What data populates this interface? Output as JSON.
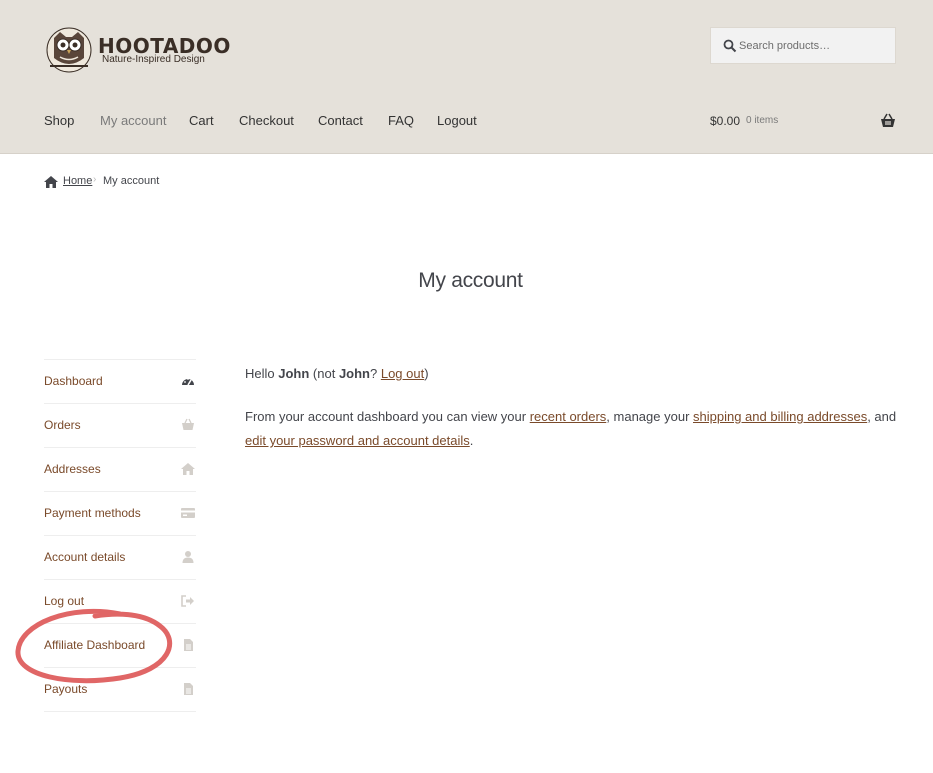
{
  "header": {
    "brand_name": "HOOTADOO",
    "tagline": "Nature-Inspired Design",
    "search_placeholder": "Search products…",
    "bg_color": "#e5e1da"
  },
  "nav": {
    "items": [
      {
        "label": "Shop"
      },
      {
        "label": "My account",
        "current": true
      },
      {
        "label": "Cart"
      },
      {
        "label": "Checkout"
      },
      {
        "label": "Contact"
      },
      {
        "label": "FAQ"
      },
      {
        "label": "Logout"
      }
    ]
  },
  "cart": {
    "amount": "$0.00",
    "count": "0 items",
    "icon": "basket-icon"
  },
  "breadcrumb": {
    "home_label": "Home",
    "separator": "›",
    "current": "My account"
  },
  "page_title": "My account",
  "account_nav": {
    "items": [
      {
        "label": "Dashboard",
        "icon": "dashboard-icon"
      },
      {
        "label": "Orders",
        "icon": "basket-icon"
      },
      {
        "label": "Addresses",
        "icon": "home-icon"
      },
      {
        "label": "Payment methods",
        "icon": "credit-card-icon"
      },
      {
        "label": "Account details",
        "icon": "user-icon"
      },
      {
        "label": "Log out",
        "icon": "sign-out-icon"
      },
      {
        "label": "Affiliate Dashboard",
        "icon": "file-icon"
      },
      {
        "label": "Payouts",
        "icon": "file-icon"
      }
    ]
  },
  "dashboard": {
    "hello_prefix": "Hello ",
    "user_name": "John",
    "not_prefix": " (not ",
    "not_name": "John",
    "question": "? ",
    "logout_link": "Log out",
    "close_paren": ")",
    "intro_text": "From your account dashboard you can view your ",
    "recent_orders_link": "recent orders",
    "manage_text": ", manage your ",
    "addresses_link": "shipping and billing addresses",
    "and_text": ", and ",
    "account_details_link": "edit your password and account details",
    "period": "."
  },
  "colors": {
    "link": "#7a4a2a",
    "annotation": "#e06666"
  }
}
